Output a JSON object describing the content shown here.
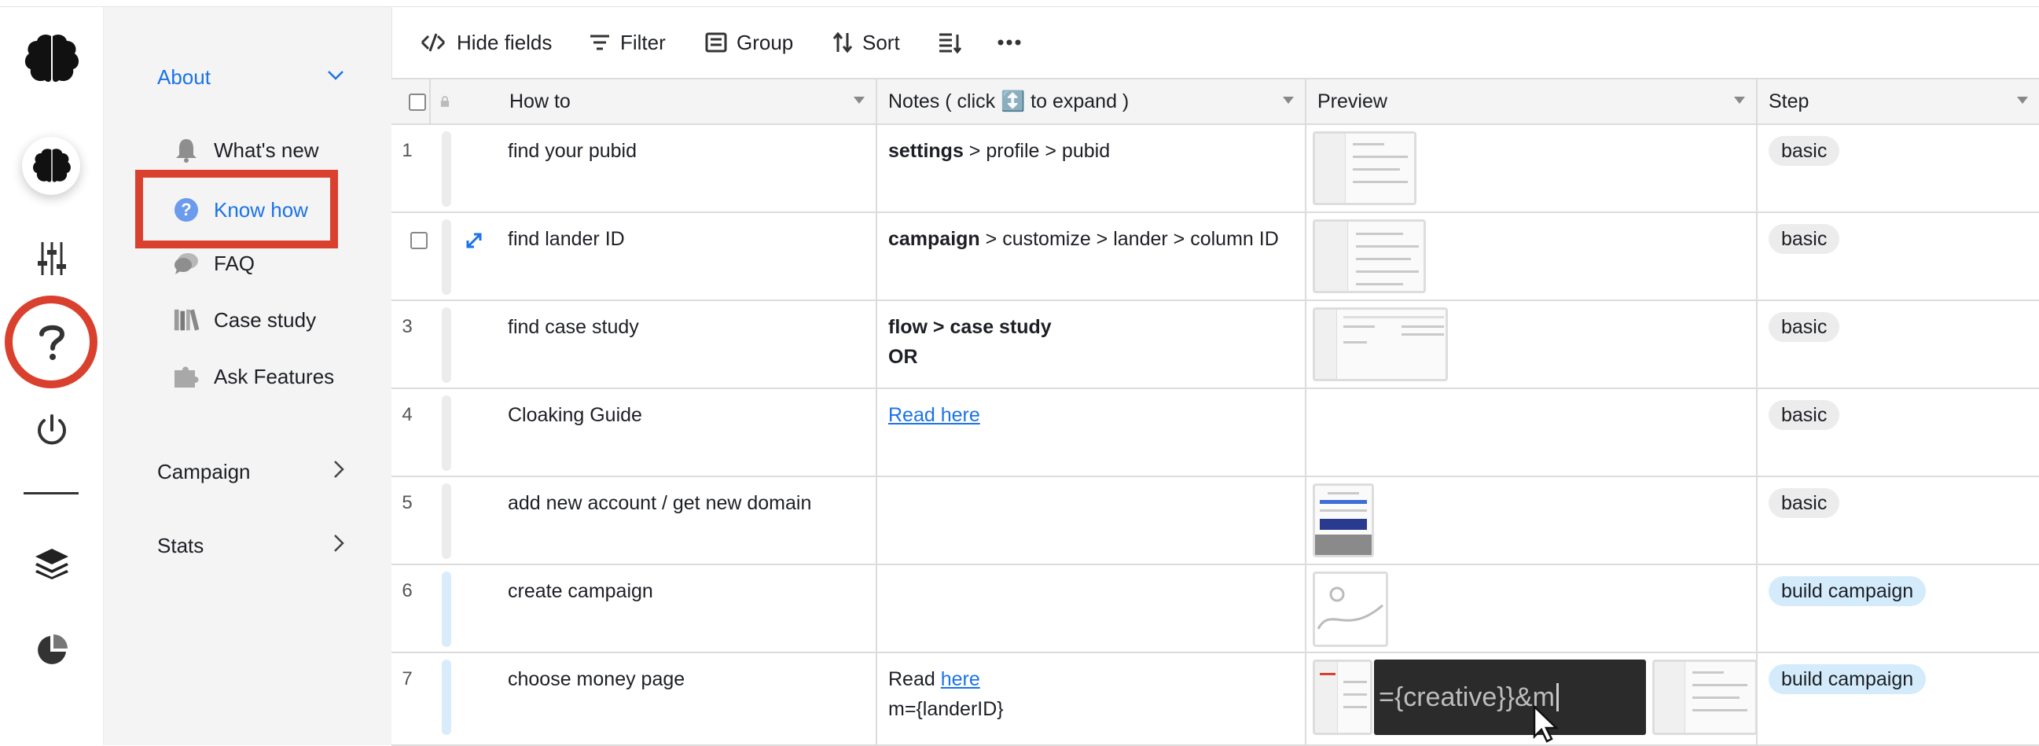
{
  "sidebar_nav": {
    "about_label": "About",
    "items": [
      {
        "label": "What's new",
        "icon": "bell-icon"
      },
      {
        "label": "Know how",
        "icon": "question-circle-icon",
        "active": true
      },
      {
        "label": "FAQ",
        "icon": "chat-bubble-icon"
      },
      {
        "label": "Case study",
        "icon": "books-icon"
      },
      {
        "label": "Ask Features",
        "icon": "puzzle-icon"
      }
    ],
    "campaign_label": "Campaign",
    "stats_label": "Stats"
  },
  "toolbar": {
    "hide_fields": "Hide fields",
    "filter": "Filter",
    "group": "Group",
    "sort": "Sort"
  },
  "columns": {
    "how_to": "How to",
    "notes": "Notes ( click ↕️ to expand )",
    "preview": "Preview",
    "step": "Step"
  },
  "rows": [
    {
      "num": "1",
      "how_to": "find your pubid",
      "notes_bold": "settings",
      "notes_rest": " > profile > pubid",
      "step": "basic"
    },
    {
      "num": "",
      "how_to": "find lander ID",
      "notes_bold": "campaign",
      "notes_rest": " > customize > lander > column ID",
      "step": "basic"
    },
    {
      "num": "3",
      "how_to": "find case study",
      "notes_line1": "flow > case study",
      "notes_line2": "OR",
      "step": "basic"
    },
    {
      "num": "4",
      "how_to": "Cloaking Guide",
      "notes_link": "Read here ",
      "step": "basic"
    },
    {
      "num": "5",
      "how_to": "add new account / get new domain",
      "step": "basic"
    },
    {
      "num": "6",
      "how_to": "create campaign",
      "step": "build campaign"
    },
    {
      "num": "7",
      "how_to": "choose money page",
      "notes_prefix": "Read ",
      "notes_link": "here",
      "notes_line2": "m={landerID}",
      "preview_text": "={creative}}&m",
      "step": "build campaign"
    }
  ],
  "colors": {
    "accent": "#1a73e8",
    "highlight": "#d9412e",
    "pill_gray": "#ececec",
    "pill_blue": "#d3ebfb"
  }
}
